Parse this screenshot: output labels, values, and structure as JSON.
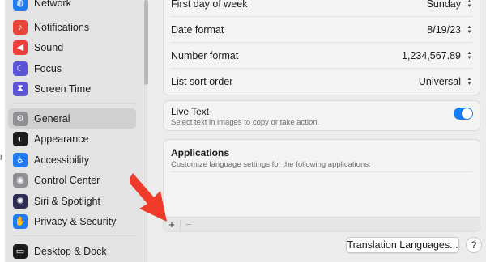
{
  "sidebar": {
    "items": [
      {
        "label": "Network",
        "icon": "globe-icon",
        "color": "#1f7bf2"
      },
      {
        "label": "Notifications",
        "icon": "bell-icon",
        "color": "#e8443a"
      },
      {
        "label": "Sound",
        "icon": "speaker-icon",
        "color": "#ea3f3a"
      },
      {
        "label": "Focus",
        "icon": "moon-icon",
        "color": "#5b54d6"
      },
      {
        "label": "Screen Time",
        "icon": "hourglass-icon",
        "color": "#5b54d6"
      },
      {
        "label": "General",
        "icon": "gear-icon",
        "color": "#8e8e93"
      },
      {
        "label": "Appearance",
        "icon": "appearance-icon",
        "color": "#1c1c1e"
      },
      {
        "label": "Accessibility",
        "icon": "accessibility-icon",
        "color": "#1f7bf2"
      },
      {
        "label": "Control Center",
        "icon": "control-center-icon",
        "color": "#8e8e93"
      },
      {
        "label": "Siri & Spotlight",
        "icon": "siri-icon",
        "color": "#2c2c54"
      },
      {
        "label": "Privacy & Security",
        "icon": "hand-icon",
        "color": "#1f7bf2"
      },
      {
        "label": "Desktop & Dock",
        "icon": "dock-icon",
        "color": "#1c1c1e"
      }
    ],
    "active": "General"
  },
  "format_rows": [
    {
      "label": "First day of week",
      "value": "Sunday"
    },
    {
      "label": "Date format",
      "value": "8/19/23"
    },
    {
      "label": "Number format",
      "value": "1,234,567.89"
    },
    {
      "label": "List sort order",
      "value": "Universal"
    }
  ],
  "live_text": {
    "title": "Live Text",
    "subtitle": "Select text in images to copy or take action.",
    "enabled": true,
    "accent": "#1a7cf5"
  },
  "applications": {
    "title": "Applications",
    "subtitle": "Customize language settings for the following applications:",
    "add_label": "+",
    "remove_label": "−"
  },
  "buttons": {
    "translation_languages": "Translation Languages...",
    "help": "?"
  },
  "annotation": {
    "color": "#f03a2a"
  }
}
